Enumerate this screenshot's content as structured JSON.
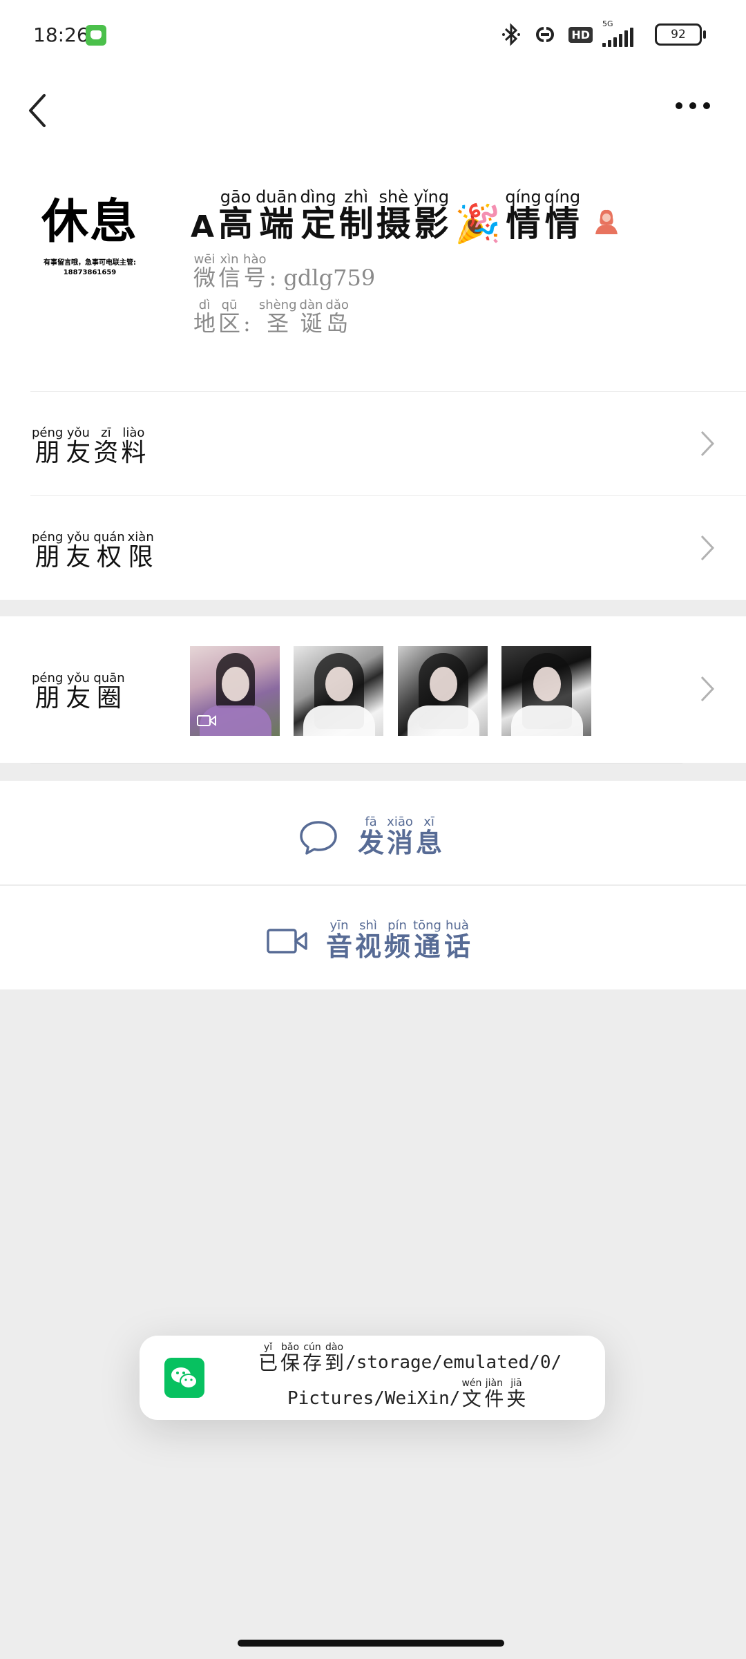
{
  "status_bar": {
    "time": "18:26",
    "network_label": "5G",
    "hd_label": "HD",
    "battery": "92"
  },
  "profile": {
    "name_prefix": "A",
    "name_title": [
      {
        "py": "gāo",
        "ch": "高"
      },
      {
        "py": "duān",
        "ch": "端"
      },
      {
        "py": "dìng",
        "ch": "定"
      },
      {
        "py": "zhì",
        "ch": "制"
      },
      {
        "py": "shè",
        "ch": "摄"
      },
      {
        "py": "yǐng",
        "ch": "影"
      }
    ],
    "name_emoji": "🎉",
    "name_tail": [
      {
        "py": "qíng",
        "ch": "情"
      },
      {
        "py": "qíng",
        "ch": "情"
      }
    ],
    "wechat_id_label": [
      {
        "py": "wēi",
        "ch": "微"
      },
      {
        "py": "xìn",
        "ch": "信"
      },
      {
        "py": "hào",
        "ch": "号"
      }
    ],
    "wechat_id_value": ": gdlg759",
    "region_label": [
      {
        "py": "dì",
        "ch": "地"
      },
      {
        "py": "qū",
        "ch": "区"
      }
    ],
    "region_sep": ":",
    "region_value": [
      {
        "py": "shèng",
        "ch": "圣"
      },
      {
        "py": "dàn",
        "ch": "诞"
      },
      {
        "py": "dǎo",
        "ch": "岛"
      }
    ],
    "avatar_text_big": "休息",
    "avatar_text_small_1": "有事留言哦，急事可电联主管:",
    "avatar_text_small_2": "18873861659"
  },
  "menu": {
    "friend_info": [
      {
        "py": "péng",
        "ch": "朋"
      },
      {
        "py": "yǒu",
        "ch": "友"
      },
      {
        "py": "zī",
        "ch": "资"
      },
      {
        "py": "liào",
        "ch": "料"
      }
    ],
    "friend_permissions": [
      {
        "py": "péng",
        "ch": "朋"
      },
      {
        "py": "yǒu",
        "ch": "友"
      },
      {
        "py": "quán",
        "ch": "权"
      },
      {
        "py": "xiàn",
        "ch": "限"
      }
    ],
    "moments": [
      {
        "py": "péng",
        "ch": "朋"
      },
      {
        "py": "yǒu",
        "ch": "友"
      },
      {
        "py": "quān",
        "ch": "圈"
      }
    ]
  },
  "actions": {
    "send_message": [
      {
        "py": "fā",
        "ch": "发"
      },
      {
        "py": "xiāo",
        "ch": "消"
      },
      {
        "py": "xī",
        "ch": "息"
      }
    ],
    "video_call": [
      {
        "py": "yīn",
        "ch": "音"
      },
      {
        "py": "shì",
        "ch": "视"
      },
      {
        "py": "pín",
        "ch": "频"
      },
      {
        "py": "tōng",
        "ch": "通"
      },
      {
        "py": "huà",
        "ch": "话"
      }
    ]
  },
  "toast": {
    "line1_ruby": [
      {
        "py": "yǐ",
        "ch": "已"
      },
      {
        "py": "bǎo",
        "ch": "保"
      },
      {
        "py": "cún",
        "ch": "存"
      },
      {
        "py": "dào",
        "ch": "到"
      }
    ],
    "line1_path": "/storage/emulated/0/",
    "line2_path": "Pictures/WeiXin/",
    "line2_ruby": [
      {
        "py": "wén",
        "ch": "文"
      },
      {
        "py": "jiàn",
        "ch": "件"
      },
      {
        "py": "jiā",
        "ch": "夹"
      }
    ]
  },
  "colors": {
    "link_blue": "#576b95",
    "wechat_green": "#07c160",
    "page_bg": "#ededed"
  }
}
